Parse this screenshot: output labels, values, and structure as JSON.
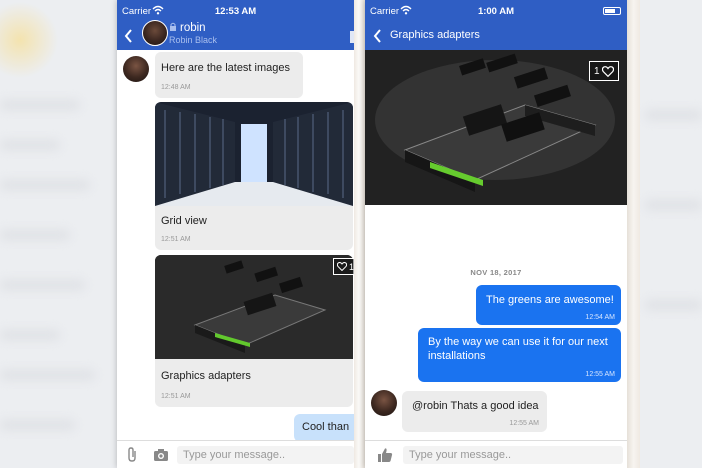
{
  "left_phone": {
    "status": {
      "carrier": "Carrier",
      "time": "12:53 AM"
    },
    "header": {
      "name": "robin",
      "subtitle": "Robin Black"
    },
    "messages": [
      {
        "text": "Here are the latest images",
        "time": "12:48 AM"
      },
      {
        "caption": "Grid view",
        "time": "12:51 AM"
      },
      {
        "caption": "Graphics adapters",
        "time": "12:51 AM",
        "likes": "1"
      },
      {
        "text": "Cool than"
      }
    ],
    "input": {
      "placeholder": "Type your message.."
    }
  },
  "right_phone": {
    "status": {
      "carrier": "Carrier",
      "time": "1:00 AM"
    },
    "header": {
      "title": "Graphics adapters"
    },
    "image": {
      "likes": "1"
    },
    "date_separator": "NOV 18, 2017",
    "messages": [
      {
        "text": "The greens are awesome!",
        "time": "12:54 AM",
        "direction": "out"
      },
      {
        "text": "By the way we can use it for our next installations",
        "time": "12:55 AM",
        "direction": "out"
      },
      {
        "text": "@robin Thats a good idea",
        "time": "12:55 AM",
        "direction": "in"
      }
    ],
    "input": {
      "placeholder": "Type your message.."
    }
  },
  "colors": {
    "header": "#2f5ec4",
    "outgoing_bubble": "#1a73f0",
    "incoming_bubble": "#ececec"
  },
  "icons": [
    "wifi-icon",
    "battery-icon",
    "back-icon",
    "lock-icon",
    "heart-icon",
    "paperclip-icon",
    "camera-icon",
    "thumbs-up-icon"
  ]
}
